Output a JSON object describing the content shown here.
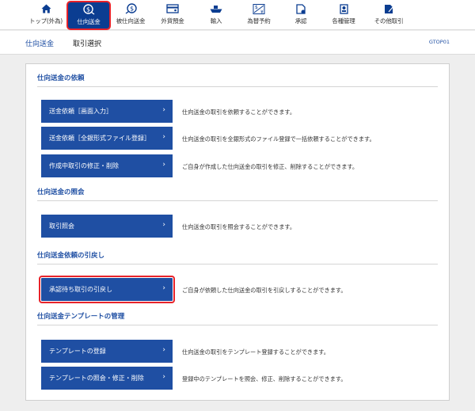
{
  "nav": {
    "tabs": [
      {
        "label": "トップ(外為)",
        "icon": "home-icon"
      },
      {
        "label": "仕向送金",
        "icon": "remittance-icon",
        "active": true
      },
      {
        "label": "被仕向送金",
        "icon": "incoming-remittance-icon"
      },
      {
        "label": "外貨預金",
        "icon": "deposit-icon"
      },
      {
        "label": "輸入",
        "icon": "ship-icon"
      },
      {
        "label": "為替予約",
        "icon": "exchange-icon"
      },
      {
        "label": "承認",
        "icon": "approval-icon"
      },
      {
        "label": "各種管理",
        "icon": "management-icon"
      },
      {
        "label": "その他取引",
        "icon": "other-transaction-icon"
      }
    ]
  },
  "breadcrumb": {
    "section": "仕向送金",
    "page": "取引選択",
    "screen_id": "GTOP01"
  },
  "sections": [
    {
      "title": "仕向送金の依頼",
      "items": [
        {
          "button": "送金依頼［画面入力］",
          "desc": "仕向送金の取引を依頼することができます。"
        },
        {
          "button": "送金依頼［全銀形式ファイル登録］",
          "desc": "仕向送金の取引を全銀形式のファイル登録で一括依頼することができます。"
        },
        {
          "button": "作成中取引の修正・削除",
          "desc": "ご自身が作成した仕向送金の取引を修正、削除することができます。"
        }
      ]
    },
    {
      "title": "仕向送金の照会",
      "items": [
        {
          "button": "取引照会",
          "desc": "仕向送金の取引を照会することができます。"
        }
      ]
    },
    {
      "title": "仕向送金依頼の引戻し",
      "items": [
        {
          "button": "承認待ち取引の引戻し",
          "desc": "ご自身が依頼した仕向送金の取引を引戻しすることができます。"
        }
      ]
    },
    {
      "title": "仕向送金テンプレートの管理",
      "items": [
        {
          "button": "テンプレートの登録",
          "desc": "仕向送金の取引をテンプレート登録することができます。"
        },
        {
          "button": "テンプレートの照会・修正・削除",
          "desc": "登録中のテンプレートを照会、修正、削除することができます。"
        }
      ]
    }
  ],
  "chevron": "›",
  "colors": {
    "primary": "#1f4fa3",
    "highlight": "#e8232a",
    "nav_active": "#0b3d91"
  }
}
